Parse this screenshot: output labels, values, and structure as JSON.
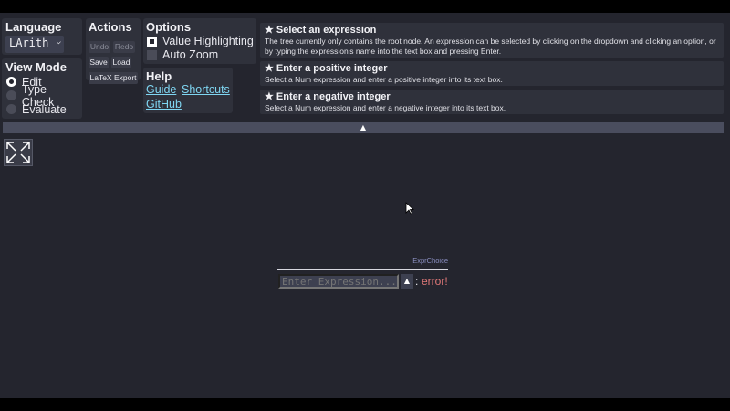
{
  "language": {
    "title": "Language",
    "selected": "LArith"
  },
  "view_mode": {
    "title": "View Mode",
    "options": [
      "Edit",
      "Type-Check",
      "Evaluate"
    ],
    "selected": "Edit"
  },
  "actions": {
    "title": "Actions",
    "undo": "Undo",
    "redo": "Redo",
    "save": "Save",
    "load": "Load",
    "latex_export": "LaTeX Export"
  },
  "options": {
    "title": "Options",
    "value_highlighting": "Value Highlighting",
    "value_highlighting_checked": true,
    "auto_zoom": "Auto Zoom",
    "auto_zoom_checked": false
  },
  "help": {
    "title": "Help",
    "guide": "Guide",
    "shortcuts": "Shortcuts",
    "github": "GitHub"
  },
  "tasks": [
    {
      "title": "★ Select an expression",
      "description": "The tree currently only contains the root node. An expression can be selected by clicking on the dropdown and clicking an option, or by typing the expression's name into the text box and pressing Enter."
    },
    {
      "title": "★ Enter a positive integer",
      "description": "Select a Num expression and enter a positive integer into its text box."
    },
    {
      "title": "★ Enter a negative integer",
      "description": "Select a Num expression and enter a negative integer into its text box."
    }
  ],
  "collapse_bar": {
    "icon": "▲"
  },
  "canvas": {
    "fit_icon": "expand-arrows-icon"
  },
  "expression": {
    "node_label": "ExprChoice",
    "placeholder": "Enter Expression...",
    "dropdown_icon": "▲",
    "colon": ":",
    "type": "error!"
  }
}
